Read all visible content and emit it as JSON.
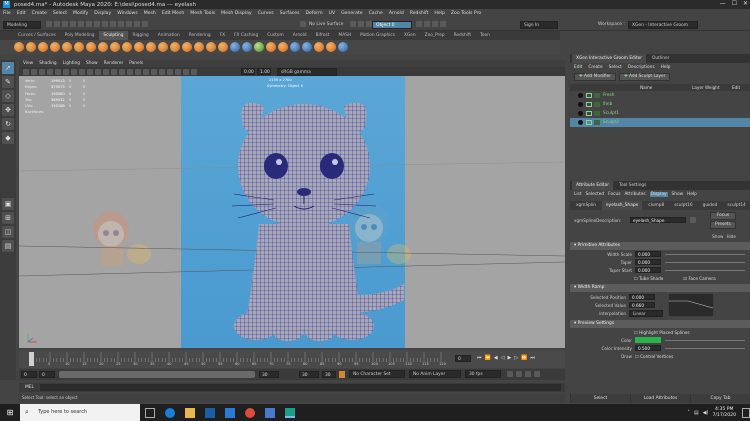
{
  "window": {
    "title": "posed4.ma* - Autodesk Maya 2020: E:\\desi\\posed4.ma  ---  eyelash",
    "controls": [
      "—",
      "☐",
      "✕"
    ]
  },
  "menubar": [
    "File",
    "Edit",
    "Create",
    "Select",
    "Modify",
    "Display",
    "Windows",
    "Mesh",
    "Edit Mesh",
    "Mesh Tools",
    "Mesh Display",
    "Curves",
    "Surfaces",
    "Deform",
    "UV",
    "Generate",
    "Cache",
    "Arnold",
    "Redshift",
    "Help",
    "Zoo Tools Pro"
  ],
  "status": {
    "workspace_mode": "Modeling",
    "no_live_surface": "No Live Surface",
    "object_field": "Object 0",
    "sign_in": "Sign In",
    "workspace_label": "Workspace :",
    "workspace_value": "XGen - Interactive Groom"
  },
  "shelf_tabs": [
    "Curves / Surfaces",
    "Poly Modeling",
    "Sculpting",
    "Rigging",
    "Animation",
    "Rendering",
    "FX",
    "FX Caching",
    "Custom",
    "Arnold",
    "Bifrost",
    "MASH",
    "Motion Graphics",
    "XGen",
    "Zoo_Prep",
    "Redshift",
    "Toon"
  ],
  "shelf_active": "Sculpting",
  "viewport_menu": [
    "View",
    "Shading",
    "Lighting",
    "Show",
    "Renderer",
    "Panels"
  ],
  "viewport": {
    "colorspace": "sRGB gamma",
    "resolution": "2155 x 2700",
    "symmetry": "Symmetry: Object X",
    "hud": [
      {
        "k": "Verts:",
        "v": "199513",
        "w": "0",
        "x": "0"
      },
      {
        "k": "Edges:",
        "v": "379573",
        "w": "0",
        "x": "0"
      },
      {
        "k": "Faces:",
        "v": "190060",
        "w": "0",
        "x": "0"
      },
      {
        "k": "Tris:",
        "v": "369032",
        "w": "0",
        "x": "0"
      },
      {
        "k": "UVs:",
        "v": "150188",
        "w": "0",
        "x": "0"
      },
      {
        "k": "Backfaces:",
        "v": "",
        "w": "",
        "x": ""
      }
    ]
  },
  "timeline": {
    "ticks": [
      "0",
      "5",
      "10",
      "15",
      "20",
      "25",
      "30",
      "35",
      "40",
      "45",
      "50",
      "55",
      "60",
      "65",
      "70",
      "75",
      "80",
      "85",
      "90",
      "95",
      "100",
      "105",
      "110",
      "115",
      "120"
    ],
    "current": "0"
  },
  "range": {
    "start": "0",
    "min": "0",
    "end": "30",
    "max_a": "30",
    "max_b": "30",
    "character_set": "No Character Set",
    "anim_layer": "No Anim Layer",
    "fps": "30 fps"
  },
  "mel_label": "MEL",
  "help_line": "Select Tool: select an object",
  "right_panel": {
    "tabs": [
      "XGen Interactive Groom Editor",
      "Outliner"
    ],
    "menu": [
      "Edit",
      "Create",
      "Select",
      "Descriptions",
      "Help"
    ],
    "add_modifier": "Add Modifier",
    "add_sculpt_layer": "Add Sculpt Layer",
    "col_name": "Name",
    "col_layer_weight": "Layer Weight",
    "col_edit": "Edit",
    "layers": [
      "Fresh",
      "lhnb",
      "Sculpt1",
      "Sculpt2"
    ],
    "selected_layer_index": 3
  },
  "attr_editor": {
    "tabs": [
      "Attribute Editor",
      "Tool Settings"
    ],
    "menu": [
      "List",
      "Selected",
      "Focus",
      "Attributes",
      "Display",
      "Show",
      "Help"
    ],
    "node_tabs": [
      "xgmSplin",
      "eyelash_Shape",
      "clump8",
      "sculpt16",
      "guide4",
      "sculpt14"
    ],
    "node_label": "xgmSplineDescription:",
    "node_value": "eyelash_Shape",
    "focus": "Focus",
    "presets": "Presets",
    "show": "Show",
    "hide": "Hide",
    "sections": {
      "primitive": "Primitive Attributes",
      "width_ramp": "Width Ramp",
      "preview": "Preview Settings"
    },
    "fields": {
      "width_scale_label": "Width Scale",
      "width_scale": "0.000",
      "taper_label": "Taper",
      "taper": "0.000",
      "taper_start_label": "Taper Start",
      "taper_start": "0.000",
      "tube_shade": "Tube Shade",
      "face_camera": "Face Camera",
      "selected_position_label": "Selected Position",
      "selected_position": "0.000",
      "selected_value_label": "Selected Value",
      "selected_value": "0.660",
      "interpolation_label": "Interpolation",
      "interpolation": "Linear",
      "highlight_label": "Highlight Placed Splines",
      "color_label": "Color",
      "color_intensity_label": "Color Intensity",
      "color_intensity": "0.500",
      "draw_label": "Draw",
      "control_vertices": "Control Vertices"
    },
    "bottom": [
      "Select",
      "Load Attributes",
      "Copy Tab"
    ]
  },
  "taskbar": {
    "search_placeholder": "Type here to search",
    "time": "4:35 PM",
    "date": "7/17/2020"
  },
  "colors": {
    "accent": "#5285a6",
    "viewport_bg": "#a4a4a4",
    "image_bg": "#5aa6d6",
    "mesh": "#1a1a9a",
    "ramp_green": "#2bb24c"
  }
}
